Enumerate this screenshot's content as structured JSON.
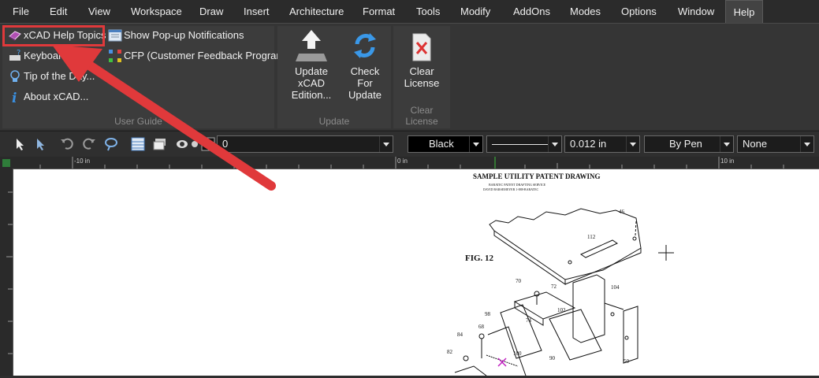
{
  "menu": {
    "items": [
      "File",
      "Edit",
      "View",
      "Workspace",
      "Draw",
      "Insert",
      "Architecture",
      "Format",
      "Tools",
      "Modify",
      "AddOns",
      "Modes",
      "Options",
      "Window",
      "Help"
    ],
    "active": "Help"
  },
  "ribbon": {
    "user_guide": {
      "label": "User Guide",
      "help_topics": "xCAD Help Topics",
      "keyboard": "Keyboard",
      "tip_of_day": "Tip of the Day...",
      "about": "About xCAD...",
      "popup_notifications": "Show Pop-up Notifications",
      "cfp": "CFP (Customer Feedback Program)"
    },
    "update": {
      "label": "Update",
      "update_edition_1": "Update xCAD",
      "update_edition_2": "Edition...",
      "check_update_1": "Check For",
      "check_update_2": "Update"
    },
    "clear_license": {
      "label": "Clear License",
      "clear_1": "Clear",
      "clear_2": "License"
    }
  },
  "toolbar": {
    "layer_value": "0",
    "color_value": "Black",
    "line_width": "0.012 in",
    "pen_value": "By Pen",
    "fill_value": "None"
  },
  "ruler": {
    "left_label": "-10 in",
    "center_label": "0 in",
    "right_label": "10 in"
  },
  "drawing": {
    "title": "SAMPLE UTILITY PATENT DRAWING",
    "subtitle1": "BARATEC PATENT DRAFTING SERVICE",
    "subtitle2": "DAVID BARSEMEYER  1-888-BARATEC",
    "fig_label": "FIG. 12",
    "part_labels": [
      "46",
      "112",
      "104",
      "70",
      "72",
      "102",
      "98",
      "74",
      "68",
      "84",
      "82",
      "100",
      "90",
      "50"
    ]
  },
  "colors": {
    "annotation_red": "#e0393b",
    "ribbon_bg": "#353535",
    "menubar_bg": "#2b2b2b"
  }
}
